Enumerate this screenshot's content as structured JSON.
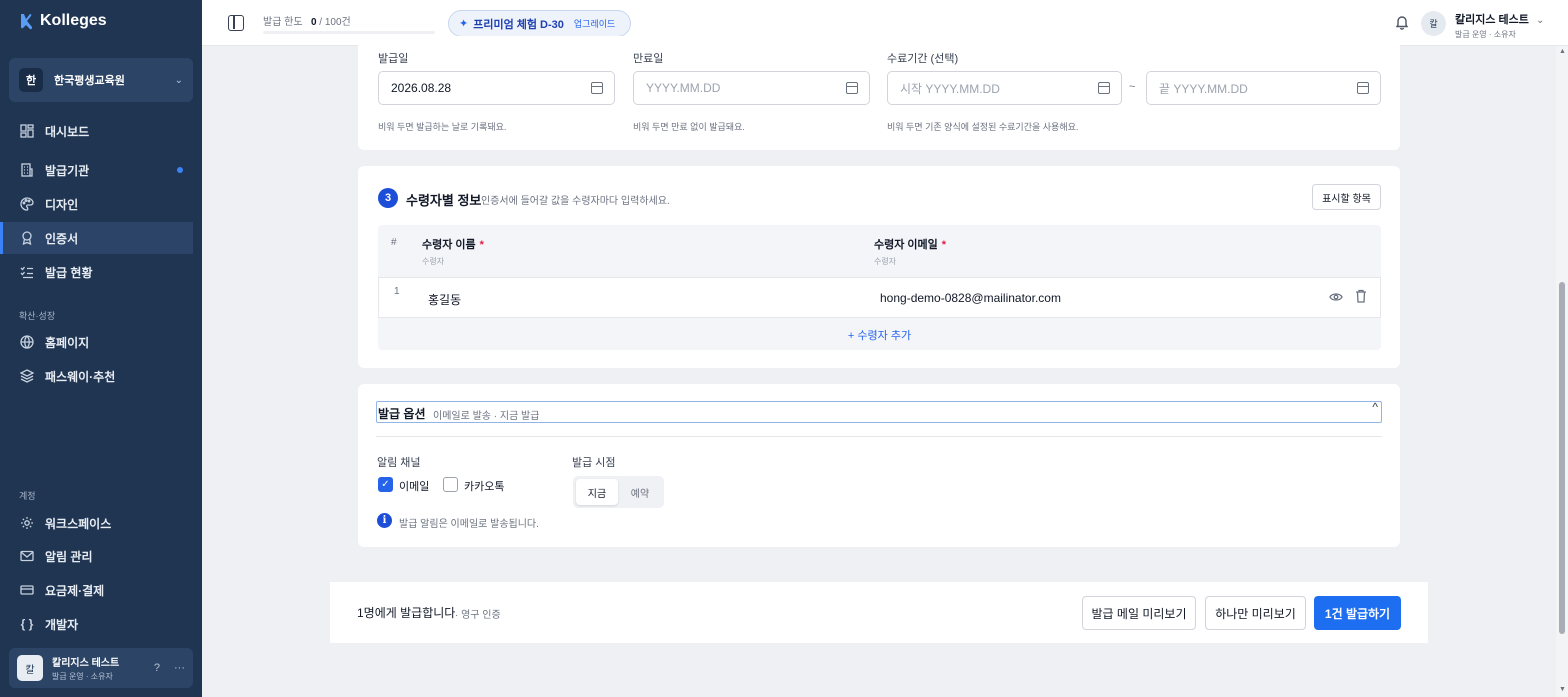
{
  "app": {
    "name": "Kolleges"
  },
  "sidebar": {
    "org": {
      "initial": "한",
      "name": "한국평생교육원"
    },
    "items": [
      {
        "label": "대시보드",
        "icon": "dashboard-icon"
      },
      {
        "label": "발급기관",
        "icon": "building-icon",
        "dot": true
      },
      {
        "label": "디자인",
        "icon": "palette-icon"
      },
      {
        "label": "인증서",
        "icon": "award-icon",
        "active": true
      },
      {
        "label": "발급 현황",
        "icon": "list-check-icon"
      }
    ],
    "section_growth": "확산·성장",
    "growth_items": [
      {
        "label": "홈페이지",
        "icon": "globe-icon"
      },
      {
        "label": "패스웨이·추천",
        "icon": "layers-icon"
      }
    ],
    "section_account": "계정",
    "account_items": [
      {
        "label": "워크스페이스",
        "icon": "gear-icon"
      },
      {
        "label": "알림 관리",
        "icon": "mail-icon"
      },
      {
        "label": "요금제·결제",
        "icon": "card-icon"
      },
      {
        "label": "개발자",
        "icon": "code-icon"
      }
    ],
    "user": {
      "initial": "칼",
      "name": "칼리지스 테스트",
      "role": "발급 운영 · 소유자"
    }
  },
  "topbar": {
    "quota_label": "발급 한도",
    "quota_used": "0",
    "quota_total": " / 100건",
    "premium_label": "프리미엄 체험 D-30",
    "upgrade_label": "업그레이드",
    "user_initial": "칼",
    "user_name": "칼리지스 테스트",
    "user_role": "발급 운영 · 소유자"
  },
  "dates": {
    "issue_label": "발급일",
    "issue_value": "2026.08.28",
    "issue_hint": "비워 두면 발급하는 날로 기록돼요.",
    "expire_label": "만료일",
    "expire_placeholder": "YYYY.MM.DD",
    "expire_hint": "비워 두면 만료 없이 발급돼요.",
    "period_label": "수료기간 (선택)",
    "period_start_placeholder": "시작 YYYY.MM.DD",
    "period_sep": "~",
    "period_end_placeholder": "끝 YYYY.MM.DD",
    "period_hint": "비워 두면 기존 양식에 설정된 수료기간을 사용해요."
  },
  "recipients": {
    "step": "3",
    "title": "수령자별 정보",
    "subtitle": "인증서에 들어갈 값을 수령자마다 입력하세요.",
    "fields_button": "표시할 항목",
    "columns": {
      "num": "#",
      "name": "수령자 이름",
      "name_sub": "수령자",
      "email": "수령자 이메일",
      "email_sub": "수령자",
      "required_mark": "*"
    },
    "rows": [
      {
        "num": "1",
        "name": "홍길동",
        "email": "hong-demo-0828@mailinator.com"
      }
    ],
    "add_label": "+ 수령자 추가"
  },
  "options": {
    "title": "발급 옵션",
    "summary": "이메일로 발송 · 지금 발급",
    "caret": "^",
    "channel_label": "알림 채널",
    "email_label": "이메일",
    "email_checked": true,
    "kakao_label": "카카오톡",
    "kakao_checked": false,
    "timing_label": "발급 시점",
    "timing_now": "지금",
    "timing_scheduled": "예약",
    "info_text": "발급 알림은 이메일로 발송됩니다."
  },
  "footer": {
    "summary": "1명에게 발급합니다",
    "sub": "· 영구 인증",
    "preview_mail": "발급 메일 미리보기",
    "preview_one": "하나만 미리보기",
    "issue": "1건 발급하기"
  },
  "colors": {
    "sidebar": "#1f3552",
    "accent": "#1d6ef0",
    "active_nav": "#2b4468"
  }
}
